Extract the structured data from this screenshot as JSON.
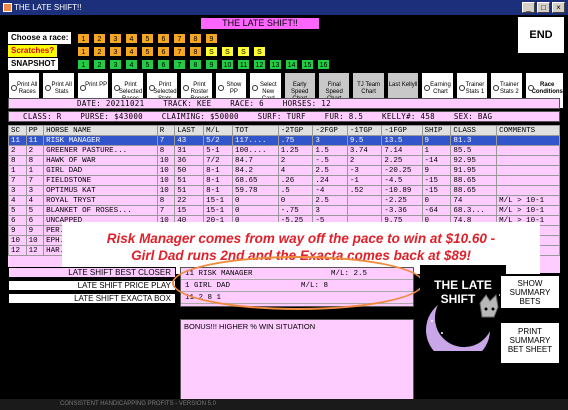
{
  "window": {
    "title": "THE LATE SHIFT!!",
    "btn_min": "_",
    "btn_max": "□",
    "btn_close": "×"
  },
  "app_title": "THE LATE SHIFT!!",
  "end_label": "END",
  "labels": {
    "choose_race": "Choose  a race:",
    "scratches": "Scratches?",
    "snapshot": "SNAPSHOT"
  },
  "race_buttons": [
    "1",
    "2",
    "3",
    "4",
    "5",
    "6",
    "7",
    "8",
    "9"
  ],
  "scratch_buttons": [
    "1",
    "2",
    "3",
    "4",
    "5",
    "6",
    "7",
    "8",
    "S",
    "S",
    "S",
    "S"
  ],
  "snapshot_buttons": [
    "1",
    "2",
    "3",
    "4",
    "5",
    "6",
    "7",
    "8",
    "9",
    "10",
    "11",
    "12",
    "13",
    "14",
    "15",
    "16"
  ],
  "toolbar": [
    {
      "label": "Print All Races",
      "radio": true
    },
    {
      "label": "Print All Stats",
      "radio": true
    },
    {
      "label": "Print PP",
      "radio": true
    },
    {
      "label": "Print Selected Races",
      "radio": true
    },
    {
      "label": "Print Selected Stats",
      "radio": true
    },
    {
      "label": "Print Roster Report",
      "radio": true
    },
    {
      "label": "Show PP",
      "radio": true
    },
    {
      "label": "Select New Card",
      "radio": true
    },
    {
      "label": "Early Speed Chart",
      "radio": false
    },
    {
      "label": "Final Speed Chart",
      "radio": false
    },
    {
      "label": "TJ Team Chart",
      "radio": false
    },
    {
      "label": "Last Kellyll",
      "radio": false
    },
    {
      "label": "Earning Chart",
      "radio": true
    },
    {
      "label": "Trainer Stats 1",
      "radio": true
    },
    {
      "label": "Trainer Stats 2",
      "radio": true
    },
    {
      "label": "Race Conditions",
      "radio": true
    }
  ],
  "info1": {
    "date": "DATE: 20211021",
    "track": "TRACK: KEE",
    "race": "RACE: 6",
    "horses": "HORSES: 12"
  },
  "info2": {
    "cls": "CLASS: R",
    "purse": "PURSE: $43000",
    "claiming": "CLAIMING: $50000",
    "surf": "SURF: TURF",
    "fur": "FUR: 8.5",
    "kelly": "KELLY#: 458",
    "sex": "SEX: BAG"
  },
  "columns": [
    "SC",
    "PP",
    "HORSE NAME",
    "R",
    "LAST",
    "M/L",
    "TOT",
    "-2TGP",
    "-2FGP",
    "-1TGP",
    "-1FGP",
    "SHIP",
    "CLASS",
    "COMMENTS"
  ],
  "rows": [
    [
      "11",
      "11",
      "RISK MANAGER",
      "7",
      "43",
      "5/2",
      "117....",
      ".75",
      "3",
      "9.5",
      "13.5",
      "9",
      "81.3",
      ""
    ],
    [
      "2",
      "2",
      "GREENER PASTURE...",
      "8",
      "31",
      "5-1",
      "100....",
      "1.25",
      "1.5",
      "3.74",
      "7.14",
      "1",
      "85.5",
      ""
    ],
    [
      "8",
      "8",
      "HAWK OF WAR",
      "10",
      "36",
      "7/2",
      "84.7",
      "2",
      "-.5",
      "2",
      "2.25",
      "-14",
      "92.95",
      ""
    ],
    [
      "1",
      "1",
      "GIRL DAD",
      "10",
      "50",
      "8-1",
      "84.2",
      "4",
      "2.5",
      "-3",
      "-20.25",
      "9",
      "91.95",
      ""
    ],
    [
      "7",
      "7",
      "FIELDSTONE",
      "10",
      "51",
      "8-1",
      "68.65",
      ".26",
      ".24",
      "-1",
      "-4.5",
      "-15",
      "88.65",
      ""
    ],
    [
      "3",
      "3",
      "OPTIMUS KAT",
      "10",
      "51",
      "8-1",
      "59.78",
      ".5",
      "-4",
      ".52",
      "-10.89",
      "-15",
      "88.65",
      ""
    ],
    [
      "4",
      "4",
      "ROYAL TRYST",
      "8",
      "22",
      "15-1",
      "0",
      "0",
      "2.5",
      "",
      "-2.25",
      "0",
      "74",
      "M/L > 10-1"
    ],
    [
      "5",
      "5",
      "BLANKET OF ROSES...",
      "7",
      "15",
      "15-1",
      "0",
      "-.75",
      "3",
      "",
      "-3.36",
      "-64",
      "68.3...",
      "M/L > 10-1"
    ],
    [
      "6",
      "6",
      "UNCAPPED",
      "10",
      "40",
      "20-1",
      "0",
      "-5.25",
      "-5",
      "",
      "9.75",
      "0",
      "74.8",
      "M/L > 10-1"
    ],
    [
      "9",
      "9",
      "PER...",
      "",
      "",
      "",
      "",
      "",
      "",
      "",
      "",
      "",
      "",
      ""
    ],
    [
      "10",
      "10",
      "EPH...",
      "",
      "",
      "",
      "",
      "",
      "",
      "",
      "",
      "",
      "",
      ""
    ],
    [
      "12",
      "12",
      "HAR...",
      "",
      "",
      "",
      "",
      "",
      "",
      "",
      "",
      "",
      "",
      ""
    ]
  ],
  "overlay": {
    "line1": "Risk Manager  comes from way off the pace to win at $10.60 -",
    "line2": "Girl Dad runs 2nd and the Exacta comes back at $89!"
  },
  "lower_buttons": [
    "LATE SHIFT BEST CLOSER",
    "LATE SHIFT PRICE PLAY",
    "LATE SHIFT EXACTA BOX"
  ],
  "picks": [
    {
      "text": "11  RISK MANAGER",
      "ml": "M/L: 2.5"
    },
    {
      "text": "1   GIRL DAD",
      "ml": "M/L: 8"
    },
    {
      "text": "11 2 8 1",
      "ml": ""
    }
  ],
  "bonus_text": "BONUS!!! HIGHER % WIN SITUATION",
  "logo_text": {
    "line1": "THE LATE",
    "line2": "SHIFT"
  },
  "right_buttons": [
    "SHOW SUMMARY BETS",
    "PRINT SUMMARY BET SHEET"
  ],
  "footer": "CONSISTENT HANDICAPPING PROFITS - VERSION 5.0",
  "colors": {
    "accent_pink": "#ffccff",
    "title_pink": "#ff66ff",
    "overlay_text": "#e0202a",
    "selection": "#3355cc",
    "ellipse": "#f08a3c"
  }
}
